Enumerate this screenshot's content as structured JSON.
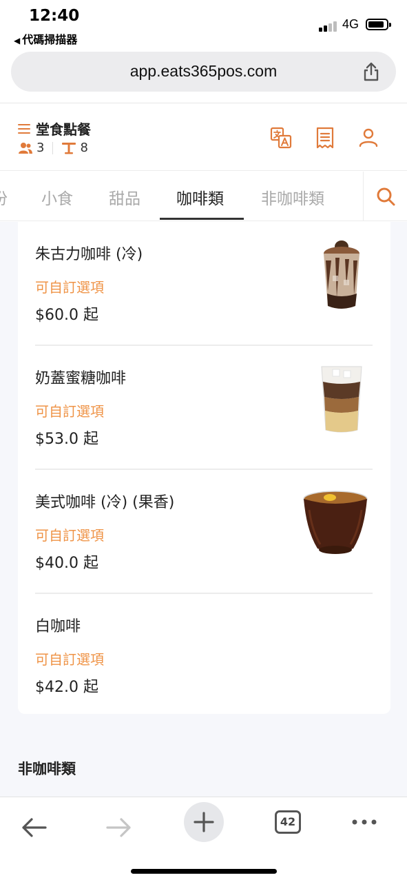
{
  "status_bar": {
    "time": "12:40",
    "back_app": "代碼掃描器",
    "network": "4G"
  },
  "browser": {
    "url": "app.eats365pos.com",
    "open_tabs": "42"
  },
  "header": {
    "title": "堂食點餐",
    "guests": "3",
    "table": "8"
  },
  "tabs": [
    {
      "label": "份"
    },
    {
      "label": "小食"
    },
    {
      "label": "甜品"
    },
    {
      "label": "咖啡類"
    },
    {
      "label": "非咖啡類"
    }
  ],
  "active_tab": "咖啡類",
  "items": [
    {
      "name": "朱古力咖啡 (冷)",
      "custom": "可自訂選項",
      "price": "$60.0 起",
      "photo": "iced-mocha"
    },
    {
      "name": "奶蓋蜜糖咖啡",
      "custom": "可自訂選項",
      "price": "$53.0 起",
      "photo": "layered-latte"
    },
    {
      "name": "美式咖啡 (冷) (果香)",
      "custom": "可自訂選項",
      "price": "$40.0 起",
      "photo": "iced-americano"
    },
    {
      "name": "白咖啡",
      "custom": "可自訂選項",
      "price": "$42.0 起",
      "photo": "none"
    }
  ],
  "next_section_title": "非咖啡類",
  "colors": {
    "accent": "#e07a3a",
    "custom_text": "#ef9346",
    "inactive_tab": "#a9a9a9"
  },
  "icons": {
    "header": [
      "translate-icon",
      "receipt-icon",
      "user-icon"
    ],
    "tabs": "search-icon",
    "toolbar": [
      "back-arrow-icon",
      "forward-arrow-icon",
      "plus-icon",
      "tabs-icon",
      "more-icon"
    ]
  }
}
